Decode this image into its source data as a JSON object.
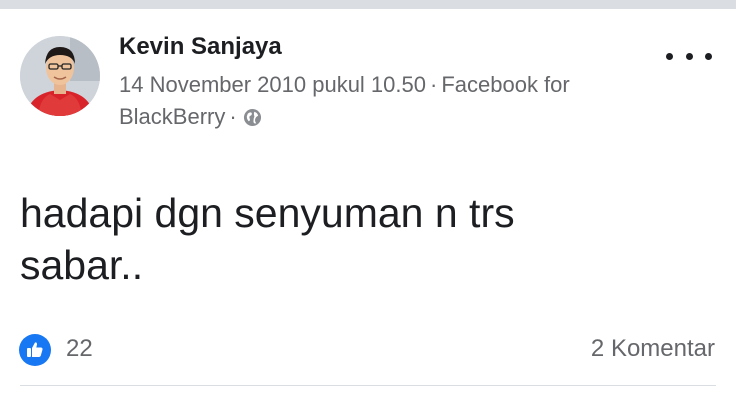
{
  "post": {
    "author": "Kevin Sanjaya",
    "date": "14 November 2010 pukul 10.50",
    "source": "Facebook for BlackBerry",
    "separator": "·",
    "privacy_icon": "globe-icon",
    "text_line1": "hadapi dgn senyuman n trs",
    "text_line2": "sabar..",
    "like_count": "22",
    "comments": "2 Komentar",
    "more_icon": "more-options-icon"
  },
  "colors": {
    "like_blue": "#1877f2",
    "meta_gray": "#65676b",
    "text": "#1c1e21"
  }
}
